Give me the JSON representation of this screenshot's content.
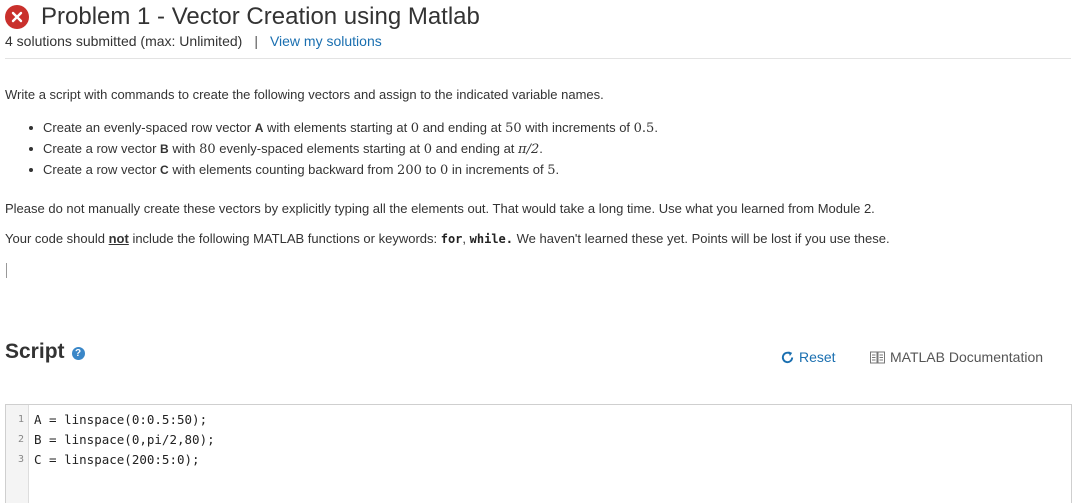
{
  "header": {
    "title": "Problem 1 - Vector Creation using Matlab",
    "submissions": "4 solutions submitted (max: Unlimited)",
    "separator": "|",
    "view_solutions_link": "View my solutions",
    "status_icon": "x-circle-icon",
    "status_color": "#c9302c"
  },
  "description": {
    "intro": "Write a script with commands to create the following vectors and assign to the indicated variable names.",
    "bullets": [
      {
        "t1": "Create an evenly-spaced row vector ",
        "var": "A",
        "t2": " with elements starting at ",
        "m1": "0",
        "t3": " and ending at ",
        "m2": "50",
        "t4": " with increments of ",
        "m3": "0.5",
        "t5": "."
      },
      {
        "t1": "Create a row vector ",
        "var": "B",
        "t2": " with ",
        "m1": "80",
        "t3": " evenly-spaced elements starting at ",
        "m2": "0",
        "t4": " and ending at ",
        "m3": "π/2",
        "t5": "."
      },
      {
        "t1": "Create a row vector ",
        "var": "C",
        "t2": " with elements counting backward from ",
        "m1": "200",
        "t3": " to ",
        "m2": "0",
        "t4": " in increments of ",
        "m3": "5",
        "t5": "."
      }
    ],
    "note": "Please do not manually create these vectors by explicitly typing all the elements out. That would take a long time. Use what you learned from Module 2.",
    "restriction": {
      "t1": "Your code should ",
      "not": "not",
      "t2": " include the following MATLAB functions or keywords: ",
      "k1": "for",
      "sep": ", ",
      "k2": "while.",
      "t3": "  We haven't learned these yet. Points will be lost if you use these."
    }
  },
  "script": {
    "title": "Script",
    "help_icon": "question-circle-icon",
    "help_glyph": "?",
    "reset_label": "Reset",
    "reset_icon": "refresh-icon",
    "doc_label": "MATLAB Documentation",
    "doc_icon": "book-icon",
    "lines": [
      {
        "num": "1",
        "code": "A = linspace(0:0.5:50);"
      },
      {
        "num": "2",
        "code": "B = linspace(0,pi/2,80);"
      },
      {
        "num": "3",
        "code": "C = linspace(200:5:0);"
      }
    ]
  },
  "colors": {
    "link": "#1a6fb0",
    "error": "#c9302c",
    "help": "#3a87c8"
  }
}
